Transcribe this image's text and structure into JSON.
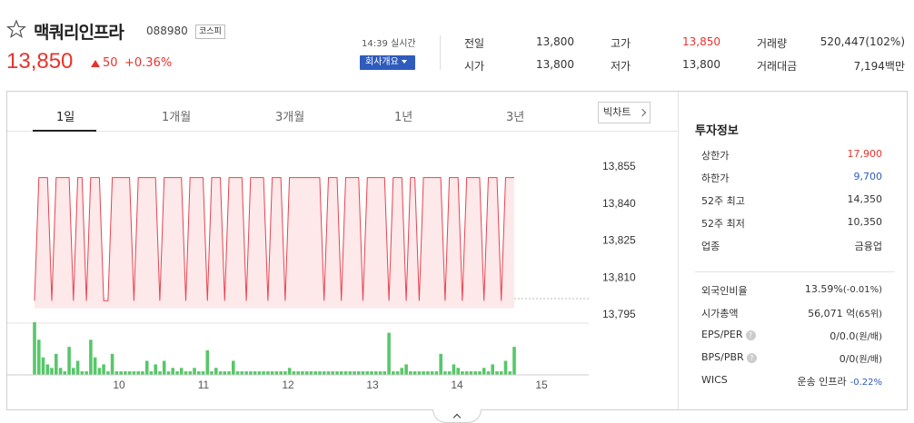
{
  "header": {
    "name": "맥쿼리인프라",
    "code": "088980",
    "market": "코스피",
    "price": "13,850",
    "change": "50",
    "change_rate": "+0.36%",
    "time": "14:39 실시간",
    "company_button": "회사개요",
    "stats": [
      {
        "label": "전일",
        "value": "13,800"
      },
      {
        "label": "시가",
        "value": "13,800"
      },
      {
        "label": "고가",
        "value": "13,850"
      },
      {
        "label": "저가",
        "value": "13,800"
      },
      {
        "label": "거래량",
        "value": "520,447(102%)"
      },
      {
        "label": "거래대금",
        "value": "7,194백만"
      }
    ]
  },
  "tabs": [
    "1일",
    "1개월",
    "3개월",
    "1년",
    "3년"
  ],
  "active_tab": "1일",
  "bigchart_label": "빅차트",
  "colors": {
    "up": "#e8332d",
    "down": "#2f5bbd",
    "volume": "#57c76a",
    "line": "#e8434e",
    "fill": "#fde8ea"
  },
  "chart_data": {
    "type": "line",
    "y_ticks": [
      "13,855",
      "13,840",
      "13,825",
      "13,810",
      "13,795"
    ],
    "ylim": [
      13795,
      13855
    ],
    "x_ticks": [
      "10",
      "11",
      "12",
      "13",
      "14",
      "15"
    ],
    "price_series": [
      13800,
      13850,
      13850,
      13850,
      13800,
      13850,
      13850,
      13850,
      13850,
      13800,
      13850,
      13850,
      13800,
      13850,
      13850,
      13850,
      13800,
      13800,
      13850,
      13850,
      13850,
      13850,
      13850,
      13800,
      13850,
      13850,
      13850,
      13850,
      13850,
      13800,
      13850,
      13850,
      13850,
      13850,
      13850,
      13800,
      13850,
      13850,
      13850,
      13850,
      13800,
      13850,
      13850,
      13850,
      13800,
      13850,
      13850,
      13850,
      13850,
      13800,
      13850,
      13850,
      13850,
      13850,
      13800,
      13850,
      13850,
      13850,
      13800,
      13850,
      13850,
      13850,
      13850,
      13850,
      13850,
      13850,
      13850,
      13800,
      13850,
      13850,
      13850,
      13800,
      13850,
      13850,
      13850,
      13850,
      13800,
      13850,
      13850,
      13850,
      13850,
      13850,
      13800,
      13850,
      13850,
      13850,
      13800,
      13850,
      13850,
      13800,
      13850,
      13850,
      13850,
      13850,
      13850,
      13800,
      13850,
      13850,
      13850,
      13800,
      13850,
      13850,
      13850,
      13850,
      13800,
      13850,
      13850,
      13850,
      13800,
      13850,
      13850,
      13850
    ],
    "volume_series": [
      15,
      10,
      5,
      3,
      2,
      6,
      2,
      1,
      8,
      2,
      4,
      1,
      1,
      10,
      5,
      2,
      3,
      1,
      6,
      1,
      1,
      1,
      1,
      1,
      1,
      1,
      4,
      1,
      3,
      1,
      4,
      1,
      2,
      1,
      2,
      1,
      1,
      2,
      1,
      1,
      7,
      1,
      2,
      1,
      1,
      1,
      4,
      1,
      1,
      1,
      1,
      1,
      1,
      1,
      1,
      1,
      1,
      1,
      1,
      2,
      1,
      1,
      1,
      1,
      1,
      1,
      1,
      1,
      1,
      1,
      1,
      1,
      1,
      1,
      1,
      1,
      1,
      1,
      1,
      1,
      1,
      1,
      12,
      1,
      1,
      2,
      3,
      1,
      1,
      1,
      1,
      1,
      1,
      1,
      6,
      1,
      1,
      3,
      2,
      1,
      1,
      1,
      1,
      1,
      2,
      1,
      3,
      1,
      1,
      4,
      1,
      8
    ]
  },
  "invest_info": {
    "title": "투자정보",
    "rows": [
      {
        "label": "상한가",
        "value": "17,900",
        "tone": "up"
      },
      {
        "label": "하한가",
        "value": "9,700",
        "tone": "down"
      },
      {
        "label": "52주 최고",
        "value": "14,350",
        "tone": "normal"
      },
      {
        "label": "52주 최저",
        "value": "10,350",
        "tone": "normal"
      },
      {
        "label": "업종",
        "value": "금융업",
        "tone": "normal"
      }
    ],
    "rows2": [
      {
        "label": "외국인비율",
        "value": "13.59%",
        "extra": "(-0.01%)",
        "extra_tone": "normal",
        "help": false
      },
      {
        "label": "시가총액",
        "value": "56,071 억",
        "extra": "(65위)",
        "extra_tone": "normal",
        "help": false
      },
      {
        "label": "EPS/PER",
        "value": "0/0.0",
        "extra": "(원/배)",
        "extra_tone": "normal",
        "help": true
      },
      {
        "label": "BPS/PBR",
        "value": "0/0",
        "extra": "(원/배)",
        "extra_tone": "normal",
        "help": true
      },
      {
        "label": "WICS",
        "value": "운송 인프라",
        "extra": "-0.22%",
        "extra_tone": "down",
        "help": false
      }
    ]
  }
}
